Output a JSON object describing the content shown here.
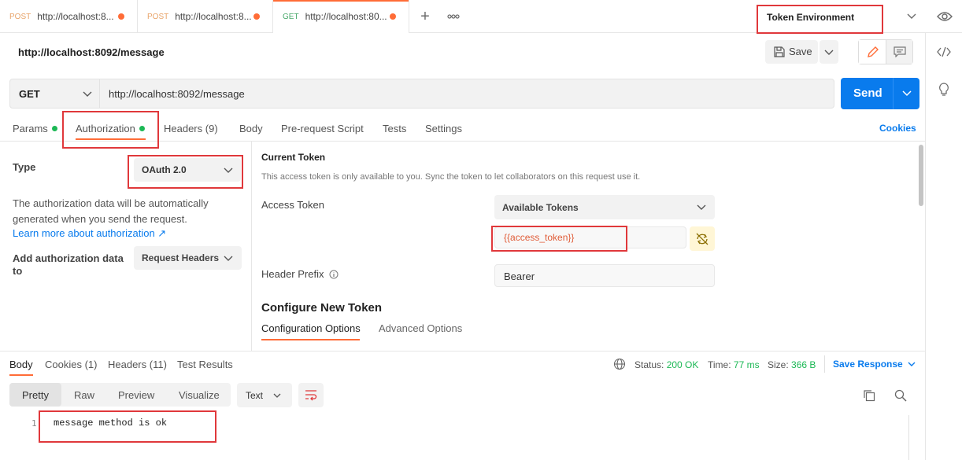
{
  "tabs": [
    {
      "method": "POST",
      "url": "http://localhost:8..."
    },
    {
      "method": "POST",
      "url": "http://localhost:8..."
    },
    {
      "method": "GET",
      "url": "http://localhost:80..."
    }
  ],
  "environment": {
    "name": "Token Environment"
  },
  "request": {
    "title": "http://localhost:8092/message",
    "method": "GET",
    "url": "http://localhost:8092/message",
    "save_label": "Save",
    "send_label": "Send"
  },
  "request_tabs": {
    "params": "Params",
    "authorization": "Authorization",
    "headers": "Headers",
    "headers_count": "(9)",
    "body": "Body",
    "prerequest": "Pre-request Script",
    "tests": "Tests",
    "settings": "Settings",
    "cookies": "Cookies"
  },
  "auth": {
    "type_label": "Type",
    "type_value": "OAuth 2.0",
    "info_line1": "The authorization data will be automatically",
    "info_line2": "generated when you send the request.",
    "learn_more": "Learn more about authorization ↗",
    "add_to_label1": "Add authorization data",
    "add_to_label2": "to",
    "add_to_value": "Request Headers",
    "current_token_title": "Current Token",
    "current_token_note": "This access token is only available to you. Sync the token to let collaborators on this request use it.",
    "access_token_label": "Access Token",
    "available_tokens": "Available Tokens",
    "token_value": "{{access_token}}",
    "header_prefix_label": "Header Prefix",
    "header_prefix_value": "Bearer",
    "configure_title": "Configure New Token",
    "config_tab": "Configuration Options",
    "advanced_tab": "Advanced Options"
  },
  "response": {
    "body_tab": "Body",
    "cookies_tab": "Cookies",
    "cookies_count": "(1)",
    "headers_tab": "Headers",
    "headers_count": "(11)",
    "test_results_tab": "Test Results",
    "status_label": "Status:",
    "status_value": "200 OK",
    "time_label": "Time:",
    "time_value": "77 ms",
    "size_label": "Size:",
    "size_value": "366 B",
    "save_response": "Save Response",
    "view_modes": [
      "Pretty",
      "Raw",
      "Preview",
      "Visualize"
    ],
    "format": "Text",
    "line_number": "1",
    "line_text": "message method is ok"
  },
  "colors": {
    "accent": "#ff6c37",
    "send": "#097bed",
    "status_ok": "#1cb855",
    "highlight": "#e0383b"
  }
}
